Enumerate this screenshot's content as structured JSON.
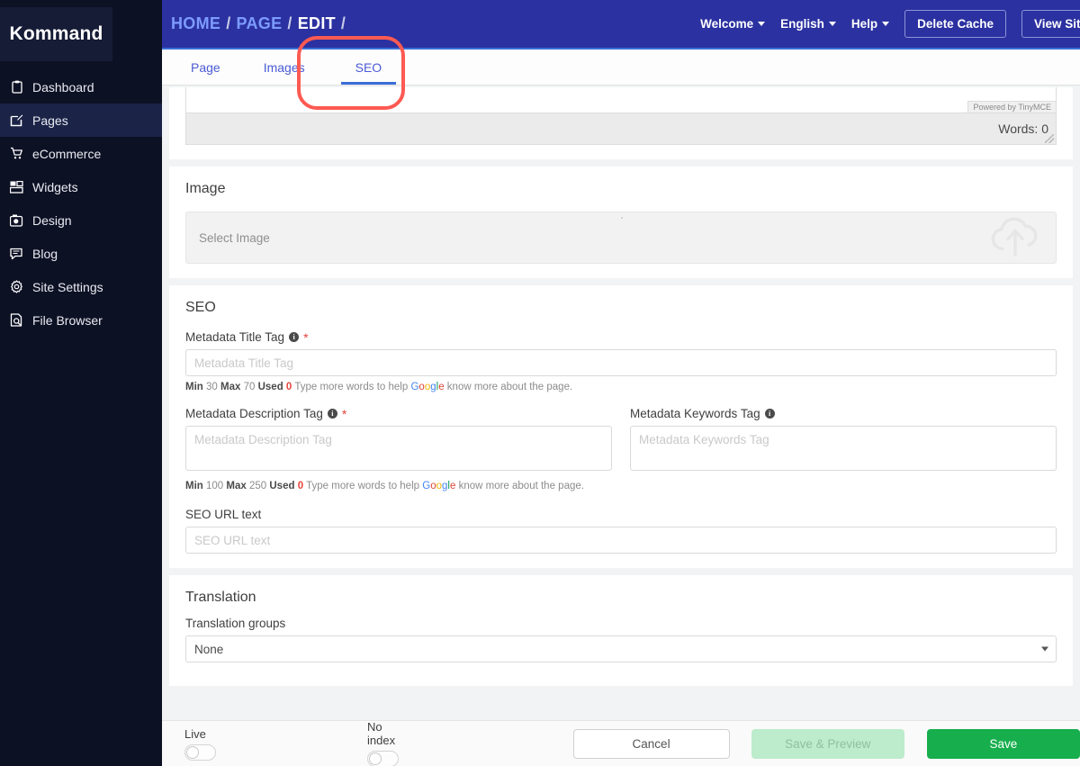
{
  "sidebar": {
    "logo": "Kommand",
    "items": [
      {
        "label": "Dashboard",
        "icon": "clipboard-icon",
        "active": false
      },
      {
        "label": "Pages",
        "icon": "edit-page-icon",
        "active": true
      },
      {
        "label": "eCommerce",
        "icon": "shopping-cart-icon",
        "active": false
      },
      {
        "label": "Widgets",
        "icon": "widgets-icon",
        "active": false
      },
      {
        "label": "Design",
        "icon": "palette-icon",
        "active": false
      },
      {
        "label": "Blog",
        "icon": "comment-icon",
        "active": false
      },
      {
        "label": "Site Settings",
        "icon": "gear-icon",
        "active": false
      },
      {
        "label": "File Browser",
        "icon": "file-search-icon",
        "active": false
      }
    ]
  },
  "topbar": {
    "breadcrumbs": [
      {
        "label": "HOME",
        "link": true
      },
      {
        "label": "PAGE",
        "link": true
      },
      {
        "label": "EDIT",
        "link": false
      }
    ],
    "separator": "/",
    "welcome": "Welcome",
    "language": "English",
    "help": "Help",
    "delete_cache": "Delete Cache",
    "view_site": "View Site",
    "background": "#2b31a0"
  },
  "tabs": [
    {
      "label": "Page",
      "active": false
    },
    {
      "label": "Images",
      "active": false
    },
    {
      "label": "SEO",
      "active": true
    }
  ],
  "editor": {
    "powered_by": "Powered by TinyMCE",
    "word_count": "Words: 0"
  },
  "image_section": {
    "title": "Image",
    "select_image_label": "Select Image",
    "upload_icon": "cloud-upload-icon"
  },
  "seo_section": {
    "title": "SEO",
    "title_tag": {
      "label": "Metadata Title Tag",
      "required": true,
      "placeholder": "Metadata Title Tag",
      "value": "",
      "hint": {
        "min_label": "Min",
        "min": "30",
        "max_label": "Max",
        "max": "70",
        "used_label": "Used",
        "used": "0",
        "text_before": "Type more words to help",
        "brand": "Google",
        "text_after": "know more about the page."
      }
    },
    "description_tag": {
      "label": "Metadata Description Tag",
      "required": true,
      "placeholder": "Metadata Description Tag",
      "value": "",
      "hint": {
        "min_label": "Min",
        "min": "100",
        "max_label": "Max",
        "max": "250",
        "used_label": "Used",
        "used": "0",
        "text_before": "Type more words to help",
        "brand": "Google",
        "text_after": "know more about the page."
      }
    },
    "keywords_tag": {
      "label": "Metadata Keywords Tag",
      "required": false,
      "placeholder": "Metadata Keywords Tag",
      "value": ""
    },
    "seo_url": {
      "label": "SEO URL text",
      "placeholder": "SEO URL text",
      "value": ""
    }
  },
  "translation_section": {
    "title": "Translation",
    "groups_label": "Translation groups",
    "groups_value": "None"
  },
  "footer": {
    "live_label": "Live",
    "live_on": false,
    "noindex_label": "No index",
    "noindex_on": false,
    "cancel": "Cancel",
    "save_preview": "Save & Preview",
    "save": "Save",
    "save_color": "#17ae4d"
  },
  "annotation": {
    "color": "#fd5a52",
    "target": "SEO tab"
  }
}
